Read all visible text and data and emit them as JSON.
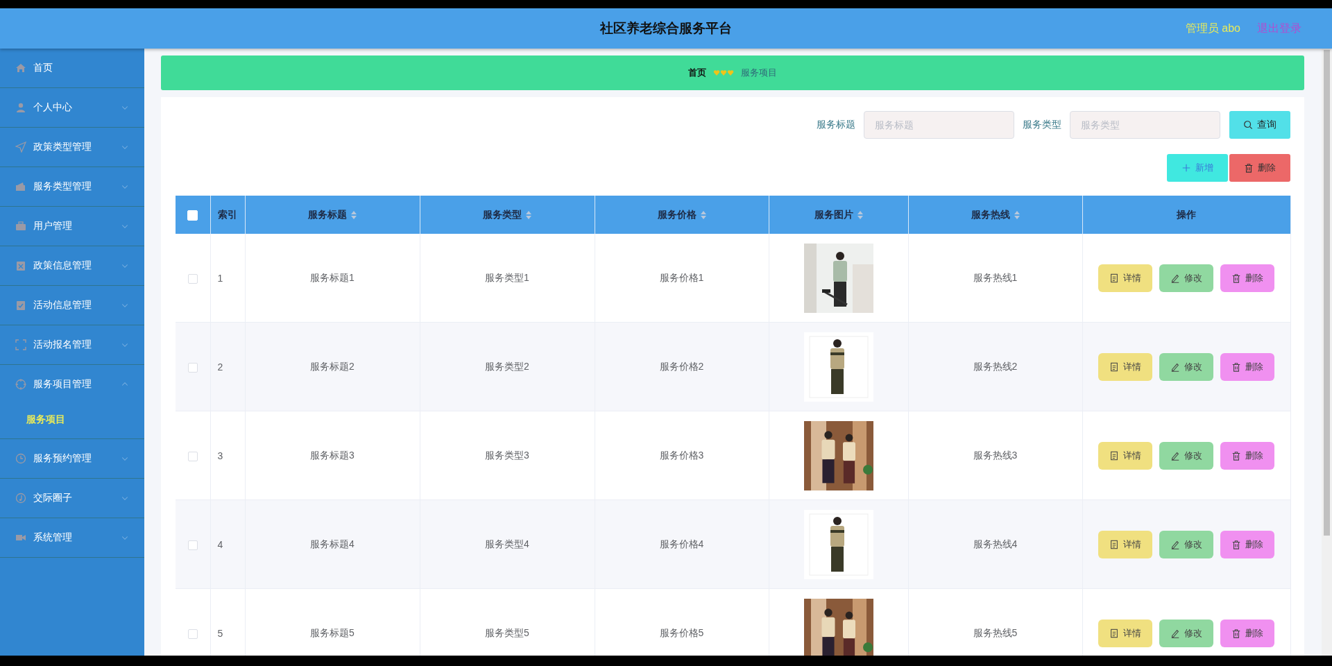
{
  "header": {
    "title": "社区养老综合服务平台",
    "user": "管理员 abo",
    "logout": "退出登录"
  },
  "sidebar": {
    "items": [
      {
        "label": "首页"
      },
      {
        "label": "个人中心",
        "expanded": false
      },
      {
        "label": "政策类型管理",
        "expanded": false
      },
      {
        "label": "服务类型管理",
        "expanded": false
      },
      {
        "label": "用户管理",
        "expanded": false
      },
      {
        "label": "政策信息管理",
        "expanded": false
      },
      {
        "label": "活动信息管理",
        "expanded": false
      },
      {
        "label": "活动报名管理",
        "expanded": false
      },
      {
        "label": "服务项目管理",
        "expanded": true,
        "children": [
          {
            "label": "服务项目",
            "selected": true
          }
        ]
      },
      {
        "label": "服务预约管理",
        "expanded": false
      },
      {
        "label": "交际圈子",
        "expanded": false
      },
      {
        "label": "系统管理",
        "expanded": false
      }
    ]
  },
  "breadcrumb": [
    "首页",
    "服务项目"
  ],
  "search": {
    "fields": [
      {
        "label": "服务标题",
        "placeholder": "服务标题"
      },
      {
        "label": "服务类型",
        "placeholder": "服务类型"
      }
    ],
    "button": "查询"
  },
  "toolbar": [
    {
      "kind": "add",
      "label": "新增"
    },
    {
      "kind": "delete",
      "label": "删除"
    }
  ],
  "table": {
    "select_all": {
      "checked": false
    },
    "columns": [
      {
        "label": "索引",
        "sortable": false
      },
      {
        "label": "服务标题",
        "sortable": true
      },
      {
        "label": "服务类型",
        "sortable": true
      },
      {
        "label": "服务价格",
        "sortable": true
      },
      {
        "label": "服务图片",
        "sortable": true
      },
      {
        "label": "服务热线",
        "sortable": true
      },
      {
        "label": "操作",
        "sortable": false
      }
    ],
    "rows": [
      {
        "checked": false,
        "index": "1",
        "title": "服务标题1",
        "type": "服务类型1",
        "price": "服务价格1",
        "hotline": "服务热线1",
        "actions": [
          {
            "kind": "detail",
            "label": "详情"
          },
          {
            "kind": "edit",
            "label": "修改"
          },
          {
            "kind": "delete",
            "label": "删除"
          }
        ]
      },
      {
        "checked": false,
        "index": "2",
        "title": "服务标题2",
        "type": "服务类型2",
        "price": "服务价格2",
        "hotline": "服务热线2",
        "actions": [
          {
            "kind": "detail",
            "label": "详情"
          },
          {
            "kind": "edit",
            "label": "修改"
          },
          {
            "kind": "delete",
            "label": "删除"
          }
        ]
      },
      {
        "checked": false,
        "index": "3",
        "title": "服务标题3",
        "type": "服务类型3",
        "price": "服务价格3",
        "hotline": "服务热线3",
        "actions": [
          {
            "kind": "detail",
            "label": "详情"
          },
          {
            "kind": "edit",
            "label": "修改"
          },
          {
            "kind": "delete",
            "label": "删除"
          }
        ]
      },
      {
        "checked": false,
        "index": "4",
        "title": "服务标题4",
        "type": "服务类型4",
        "price": "服务价格4",
        "hotline": "服务热线4",
        "actions": [
          {
            "kind": "detail",
            "label": "详情"
          },
          {
            "kind": "edit",
            "label": "修改"
          },
          {
            "kind": "delete",
            "label": "删除"
          }
        ]
      },
      {
        "checked": false,
        "index": "5",
        "title": "服务标题5",
        "type": "服务类型5",
        "price": "服务价格5",
        "hotline": "服务热线5",
        "actions": [
          {
            "kind": "detail",
            "label": "详情"
          },
          {
            "kind": "edit",
            "label": "修改"
          },
          {
            "kind": "delete",
            "label": "删除"
          }
        ]
      }
    ]
  }
}
